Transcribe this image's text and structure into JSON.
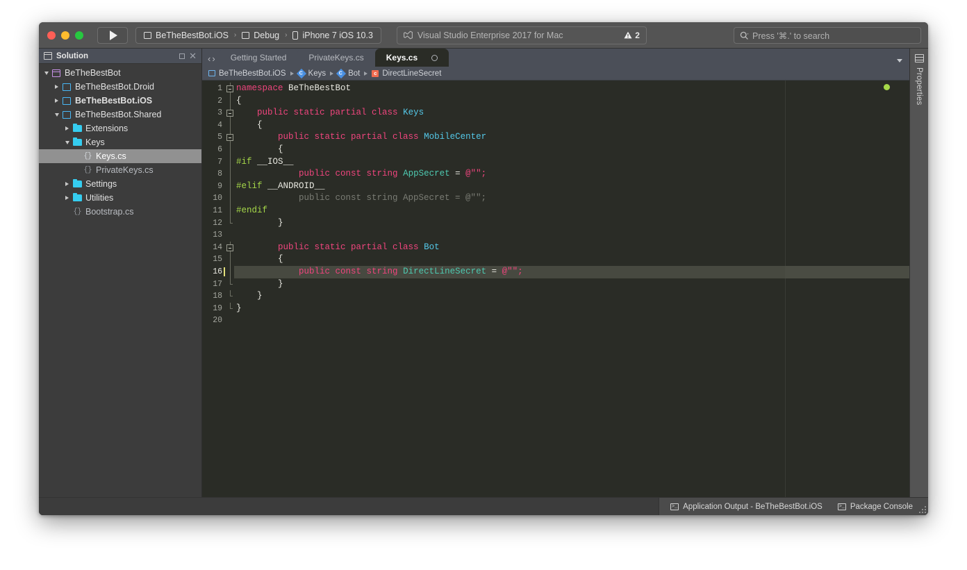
{
  "window": {
    "traffic_lights": [
      "close",
      "minimize",
      "zoom"
    ]
  },
  "toolbar": {
    "run_button": "run-play",
    "config": {
      "project": "BeTheBestBot.iOS",
      "configuration": "Debug",
      "device": "iPhone 7 iOS 10.3",
      "separator": "›"
    },
    "status": {
      "text": "Visual Studio Enterprise 2017 for Mac",
      "warning_count": "2"
    },
    "search": {
      "placeholder": "Press '⌘.' to search"
    }
  },
  "solution_pad": {
    "title": "Solution",
    "tree": [
      {
        "label": "BeTheBestBot",
        "depth": 0,
        "icon": "solution",
        "twisty": "down",
        "selected": false,
        "bold": false
      },
      {
        "label": "BeTheBestBot.Droid",
        "depth": 1,
        "icon": "project",
        "twisty": "right",
        "selected": false,
        "bold": false
      },
      {
        "label": "BeTheBestBot.iOS",
        "depth": 1,
        "icon": "project",
        "twisty": "right",
        "selected": false,
        "bold": true
      },
      {
        "label": "BeTheBestBot.Shared",
        "depth": 1,
        "icon": "project",
        "twisty": "down",
        "selected": false,
        "bold": false
      },
      {
        "label": "Extensions",
        "depth": 2,
        "icon": "folder",
        "twisty": "right",
        "selected": false,
        "bold": false
      },
      {
        "label": "Keys",
        "depth": 2,
        "icon": "folder",
        "twisty": "down",
        "selected": false,
        "bold": false
      },
      {
        "label": "Keys.cs",
        "depth": 3,
        "icon": "csfile",
        "twisty": "none",
        "selected": true,
        "bold": false
      },
      {
        "label": "PrivateKeys.cs",
        "depth": 3,
        "icon": "csfiledim",
        "twisty": "none",
        "selected": false,
        "bold": false,
        "dim": true
      },
      {
        "label": "Settings",
        "depth": 2,
        "icon": "folder",
        "twisty": "right",
        "selected": false,
        "bold": false
      },
      {
        "label": "Utilities",
        "depth": 2,
        "icon": "folder",
        "twisty": "right",
        "selected": false,
        "bold": false
      },
      {
        "label": "Bootstrap.cs",
        "depth": 2,
        "icon": "csfiledim",
        "twisty": "none",
        "selected": false,
        "bold": false,
        "dim": true
      }
    ]
  },
  "editor": {
    "tabs": [
      {
        "label": "Getting Started",
        "active": false,
        "closeable": false
      },
      {
        "label": "PrivateKeys.cs",
        "active": false,
        "closeable": false
      },
      {
        "label": "Keys.cs",
        "active": true,
        "closeable": true
      }
    ],
    "breadcrumb": [
      {
        "label": "BeTheBestBot.iOS",
        "icon": "project"
      },
      {
        "label": "Keys",
        "icon": "class"
      },
      {
        "label": "Bot",
        "icon": "class"
      },
      {
        "label": "DirectLineSecret",
        "icon": "const"
      }
    ],
    "current_line": 16,
    "status_dot_color": "#a6d949",
    "lines": [
      {
        "n": 1,
        "fold": "box",
        "tokens": [
          {
            "t": "kw",
            "v": "namespace"
          },
          {
            "t": "plain",
            "v": " "
          },
          {
            "t": "id",
            "v": "BeTheBestBot"
          }
        ]
      },
      {
        "n": 2,
        "fold": "line",
        "tokens": [
          {
            "t": "plain",
            "v": "{"
          }
        ]
      },
      {
        "n": 3,
        "fold": "box",
        "tokens": [
          {
            "t": "plain",
            "v": "    "
          },
          {
            "t": "kw",
            "v": "public static partial class"
          },
          {
            "t": "plain",
            "v": " "
          },
          {
            "t": "cls",
            "v": "Keys"
          }
        ]
      },
      {
        "n": 4,
        "fold": "line",
        "tokens": [
          {
            "t": "plain",
            "v": "    {"
          }
        ]
      },
      {
        "n": 5,
        "fold": "box",
        "tokens": [
          {
            "t": "plain",
            "v": "        "
          },
          {
            "t": "kw",
            "v": "public static partial class"
          },
          {
            "t": "plain",
            "v": " "
          },
          {
            "t": "cls",
            "v": "MobileCenter"
          }
        ]
      },
      {
        "n": 6,
        "fold": "line",
        "tokens": [
          {
            "t": "plain",
            "v": "        {"
          }
        ]
      },
      {
        "n": 7,
        "fold": "line",
        "tokens": [
          {
            "t": "pp",
            "v": "#if"
          },
          {
            "t": "plain",
            "v": " __IOS__"
          }
        ]
      },
      {
        "n": 8,
        "fold": "line",
        "tokens": [
          {
            "t": "plain",
            "v": "            "
          },
          {
            "t": "kw",
            "v": "public const string"
          },
          {
            "t": "plain",
            "v": " "
          },
          {
            "t": "type",
            "v": "AppSecret"
          },
          {
            "t": "plain",
            "v": " "
          },
          {
            "t": "op",
            "v": "="
          },
          {
            "t": "plain",
            "v": " "
          },
          {
            "t": "str",
            "v": "@\"\";"
          }
        ]
      },
      {
        "n": 9,
        "fold": "line",
        "tokens": [
          {
            "t": "pp",
            "v": "#elif"
          },
          {
            "t": "plain",
            "v": " __ANDROID__"
          }
        ]
      },
      {
        "n": 10,
        "fold": "line",
        "tokens": [
          {
            "t": "dim",
            "v": "            public const string AppSecret = @\"\";"
          }
        ]
      },
      {
        "n": 11,
        "fold": "line",
        "tokens": [
          {
            "t": "pp",
            "v": "#endif"
          }
        ]
      },
      {
        "n": 12,
        "fold": "end",
        "tokens": [
          {
            "t": "plain",
            "v": "        }"
          }
        ]
      },
      {
        "n": 13,
        "fold": "none",
        "tokens": [
          {
            "t": "plain",
            "v": ""
          }
        ]
      },
      {
        "n": 14,
        "fold": "box",
        "tokens": [
          {
            "t": "plain",
            "v": "        "
          },
          {
            "t": "kw",
            "v": "public static partial class"
          },
          {
            "t": "plain",
            "v": " "
          },
          {
            "t": "cls",
            "v": "Bot"
          }
        ]
      },
      {
        "n": 15,
        "fold": "line",
        "tokens": [
          {
            "t": "plain",
            "v": "        {"
          }
        ]
      },
      {
        "n": 16,
        "fold": "line",
        "tokens": [
          {
            "t": "plain",
            "v": "            "
          },
          {
            "t": "kw",
            "v": "public const string"
          },
          {
            "t": "plain",
            "v": " "
          },
          {
            "t": "type",
            "v": "DirectLineSecret"
          },
          {
            "t": "plain",
            "v": " "
          },
          {
            "t": "op",
            "v": "="
          },
          {
            "t": "plain",
            "v": " "
          },
          {
            "t": "str",
            "v": "@\"\";"
          }
        ]
      },
      {
        "n": 17,
        "fold": "end",
        "tokens": [
          {
            "t": "plain",
            "v": "        }"
          }
        ]
      },
      {
        "n": 18,
        "fold": "end",
        "tokens": [
          {
            "t": "plain",
            "v": "    }"
          }
        ]
      },
      {
        "n": 19,
        "fold": "end",
        "tokens": [
          {
            "t": "plain",
            "v": "}"
          }
        ]
      },
      {
        "n": 20,
        "fold": "none",
        "tokens": [
          {
            "t": "plain",
            "v": ""
          }
        ]
      }
    ]
  },
  "properties_pad": {
    "label": "Properties"
  },
  "statusbar": {
    "items": [
      {
        "label": "Application Output - BeTheBestBot.iOS",
        "icon": "terminal"
      },
      {
        "label": "Package Console",
        "icon": "terminal"
      }
    ]
  }
}
